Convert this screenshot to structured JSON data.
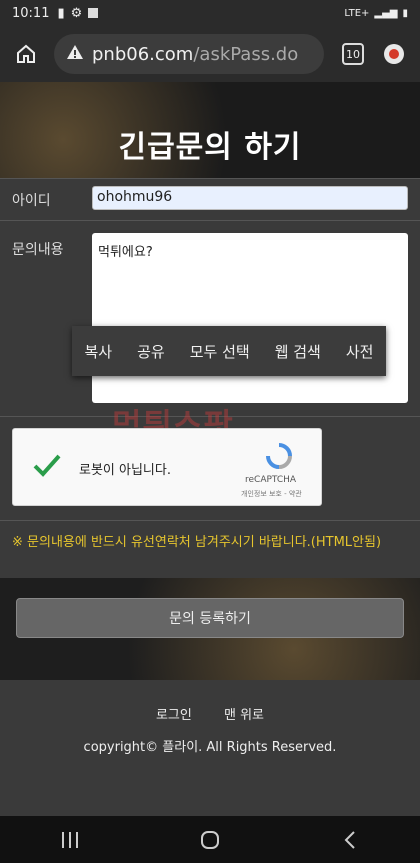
{
  "status_bar": {
    "time": "10:11",
    "network": "LTE+"
  },
  "browser": {
    "url_host": "pnb06.com",
    "url_path": "/askPass.do",
    "tab_count": "10"
  },
  "page": {
    "title": "긴급문의 하기",
    "id_label": "아이디",
    "id_value": "ohohmu96",
    "content_label": "문의내용",
    "content_value": "먹튀에요?",
    "notice": "※ 문의내용에 반드시 유선연락처 남겨주시기 바랍니다.(HTML안됨)",
    "submit_label": "문의 등록하기"
  },
  "context_menu": {
    "items": [
      "복사",
      "공유",
      "모두 선택",
      "웹 검색",
      "사전"
    ]
  },
  "watermark": "먹튀스팟",
  "captcha": {
    "label": "로봇이 아닙니다.",
    "brand": "reCAPTCHA",
    "privacy": "개인정보 보호 - 약관"
  },
  "footer": {
    "login": "로그인",
    "top": "맨 위로",
    "copyright": "copyright© 플라이. All Rights Reserved."
  },
  "colors": {
    "notice": "#e6c52e",
    "background": "#3a3a3a",
    "menu_accent": "#d43a2a"
  }
}
